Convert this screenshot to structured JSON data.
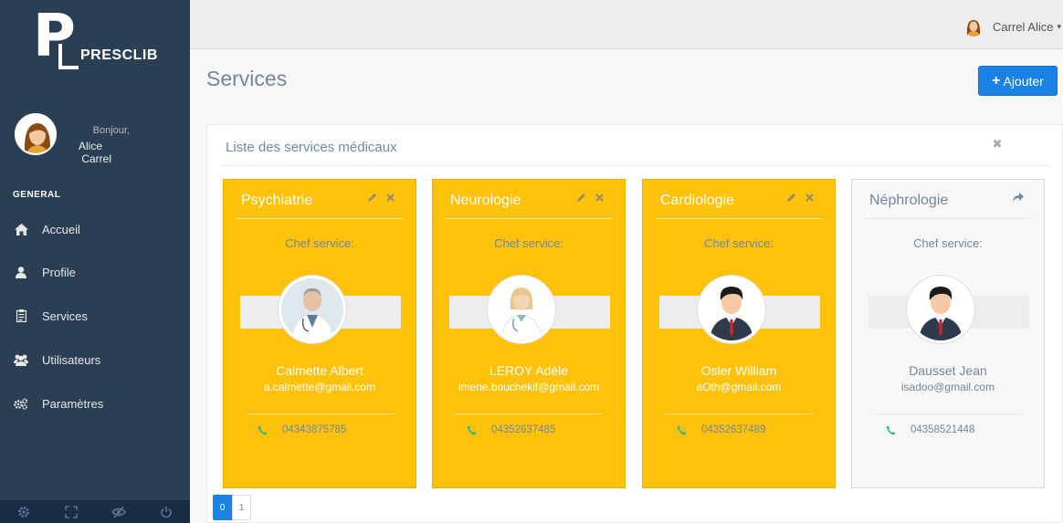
{
  "app": {
    "logo_text": "PRESCLIB"
  },
  "profile": {
    "greeting": "Bonjour,",
    "first_name": "Alice",
    "last_name": "Carrel"
  },
  "sidebar": {
    "section": "GENERAL",
    "items": [
      {
        "label": "Accueil",
        "icon": "home-icon"
      },
      {
        "label": "Profile",
        "icon": "user-icon"
      },
      {
        "label": "Services",
        "icon": "clipboard-icon"
      },
      {
        "label": "Utilisateurs",
        "icon": "users-icon"
      },
      {
        "label": "Paramètres",
        "icon": "cogs-icon"
      }
    ],
    "footer_icons": [
      "settings-icon",
      "fullscreen-icon",
      "eye-slash-icon",
      "power-icon"
    ]
  },
  "topbar": {
    "user_name": "Carrel Alice"
  },
  "page": {
    "title": "Services",
    "add_label": "Ajouter"
  },
  "panel": {
    "title": "Liste des services médicaux"
  },
  "cards": [
    {
      "title": "Psychiatrie",
      "chef_label": "Chef service:",
      "chef_name": "Calmette Albert",
      "email": "a.calmette@gmail.com",
      "phone": "04343875785",
      "style": "yellow"
    },
    {
      "title": "Neurologie",
      "chef_label": "Chef service:",
      "chef_name": "LEROY Adèle",
      "email": "imene.bouchekif@gmail.com",
      "phone": "04352637485",
      "style": "yellow"
    },
    {
      "title": "Cardiologie",
      "chef_label": "Chef service:",
      "chef_name": "Osler William",
      "email": "aOth@gmail.com",
      "phone": "04352637489",
      "style": "yellow"
    },
    {
      "title": "Néphrologie",
      "chef_label": "Chef service:",
      "chef_name": "Dausset Jean",
      "email": "isadoo@gmail.com",
      "phone": "04358521448",
      "style": "grey"
    }
  ],
  "pager": {
    "pages": [
      "0",
      "1"
    ],
    "active": "0"
  },
  "colors": {
    "sidebar": "#2a3f54",
    "accent": "#1a82e2",
    "card": "#ffc20a",
    "phone_icon": "#26b99a"
  }
}
